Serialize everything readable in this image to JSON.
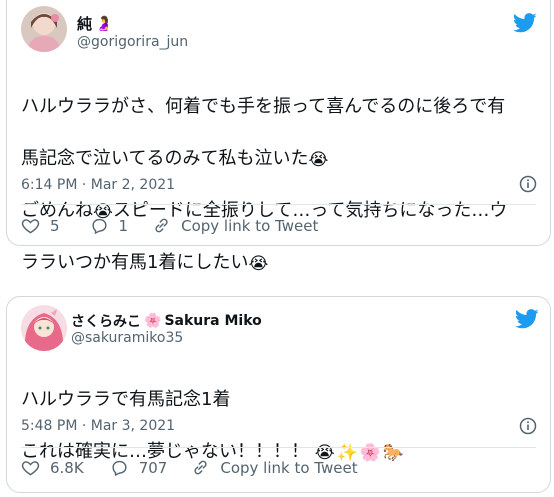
{
  "tweets": [
    {
      "display_name": "純",
      "name_emoji": "🤰",
      "handle": "@gorigorira_jun",
      "line1": "ハルウララがさ、何着でも手を振って喜んでるのに後ろで有",
      "line2": "馬記念で泣いてるのみて私も泣いた",
      "line2_emoji": "😭",
      "line3a": "ごめんね",
      "line3_emoji": "😭",
      "line3b": "スピードに全振りして…って気持ちになった…ウ",
      "line4": "ララいつか有馬1着にしたい",
      "line4_emoji": "😭",
      "timestamp": "6:14 PM · Mar 2, 2021",
      "likes": "5",
      "replies": "1",
      "copy_link": "Copy link to Tweet"
    },
    {
      "display_name_jp": "さくらみこ",
      "name_emoji": "🌸",
      "display_name_en": "Sakura Miko",
      "handle": "@sakuramiko35",
      "line1": "ハルウララで有馬記念1着",
      "line2": "これは確実に…夢じゃない！！！！ ",
      "line2_emojis": "😭✨🌸🐎",
      "timestamp": "5:48 PM · Mar 3, 2021",
      "likes": "6.8K",
      "replies": "707",
      "copy_link": "Copy link to Tweet"
    }
  ],
  "colors": {
    "twitter_blue": "#1d9bf0",
    "secondary_text": "#536471",
    "border": "#cfd9de"
  },
  "icons": [
    "twitter-bird-icon",
    "info-icon",
    "heart-icon",
    "reply-icon",
    "link-icon"
  ]
}
